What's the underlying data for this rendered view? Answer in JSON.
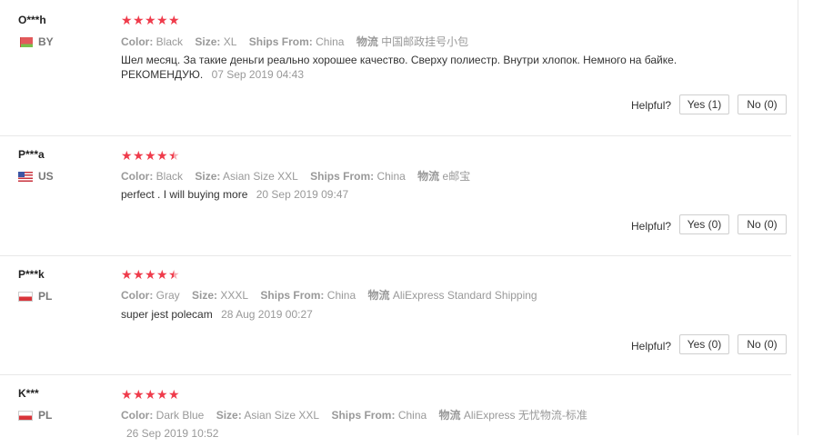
{
  "reviews": [
    {
      "user": "O***h",
      "country": "BY",
      "rating": 5,
      "meta": [
        {
          "label": "Color:",
          "value": "Black"
        },
        {
          "label": "Size:",
          "value": "XL"
        },
        {
          "label": "Ships From:",
          "value": "China"
        },
        {
          "label": "物流",
          "value": "中国邮政挂号小包"
        }
      ],
      "text_line1": "Шел месяц. За такие деньги реально хорошее качество. Сверху полиестр. Внутри хлопок. Немного на байке.",
      "text_line2": "РЕКОМЕНДУЮ.",
      "date": "07 Sep 2019 04:43",
      "helpful_label": "Helpful?",
      "yes": "Yes (1)",
      "no": "No (0)"
    },
    {
      "user": "P***a",
      "country": "US",
      "rating": 4.5,
      "meta": [
        {
          "label": "Color:",
          "value": "Black"
        },
        {
          "label": "Size:",
          "value": "Asian Size XXL"
        },
        {
          "label": "Ships From:",
          "value": "China"
        },
        {
          "label": "物流",
          "value": "e邮宝"
        }
      ],
      "text_line1": "perfect . I will buying more",
      "date": "20 Sep 2019 09:47",
      "helpful_label": "Helpful?",
      "yes": "Yes (0)",
      "no": "No (0)"
    },
    {
      "user": "P***k",
      "country": "PL",
      "rating": 4.5,
      "meta": [
        {
          "label": "Color:",
          "value": "Gray"
        },
        {
          "label": "Size:",
          "value": "XXXL"
        },
        {
          "label": "Ships From:",
          "value": "China"
        },
        {
          "label": "物流",
          "value": "AliExpress Standard Shipping"
        }
      ],
      "text_line1": "super jest polecam",
      "date": "28 Aug 2019 00:27",
      "helpful_label": "Helpful?",
      "yes": "Yes (0)",
      "no": "No (0)"
    },
    {
      "user": "K***",
      "country": "PL",
      "rating": 5,
      "meta": [
        {
          "label": "Color:",
          "value": "Dark Blue"
        },
        {
          "label": "Size:",
          "value": "Asian Size XXL"
        },
        {
          "label": "Ships From:",
          "value": "China"
        },
        {
          "label": "物流",
          "value": "AliExpress 无忧物流-标准"
        }
      ],
      "date": "26 Sep 2019 10:52"
    }
  ]
}
